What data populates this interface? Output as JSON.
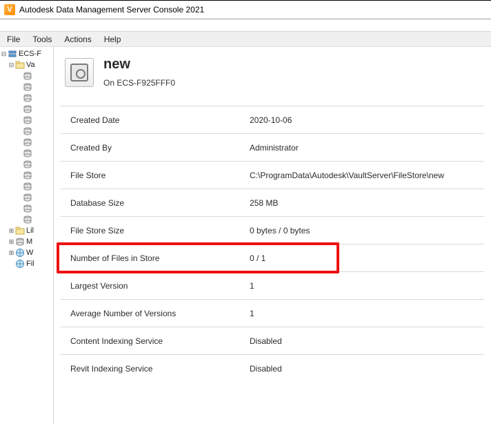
{
  "window": {
    "title": "Autodesk Data Management Server Console 2021"
  },
  "menu": {
    "file": "File",
    "tools": "Tools",
    "actions": "Actions",
    "help": "Help"
  },
  "tree": {
    "root": "ECS-F",
    "vaults": "Va",
    "li": "Lil",
    "m": "M",
    "w": "W",
    "fil": "Fil"
  },
  "header": {
    "title": "new",
    "subtitle": "On ECS-F925FFF0"
  },
  "props": [
    {
      "label": "Created Date",
      "value": "2020-10-06"
    },
    {
      "label": "Created By",
      "value": "Administrator"
    },
    {
      "label": "File Store",
      "value": "C:\\ProgramData\\Autodesk\\VaultServer\\FileStore\\new"
    },
    {
      "label": "Database Size",
      "value": "258 MB"
    },
    {
      "label": "File Store Size",
      "value": "0 bytes / 0 bytes"
    },
    {
      "label": "Number of Files in Store",
      "value": "0 / 1",
      "highlight": true
    },
    {
      "label": "Largest Version",
      "value": "1"
    },
    {
      "label": "Average Number of Versions",
      "value": "1"
    },
    {
      "label": "Content Indexing Service",
      "value": "Disabled"
    },
    {
      "label": "Revit Indexing Service",
      "value": "Disabled"
    }
  ]
}
